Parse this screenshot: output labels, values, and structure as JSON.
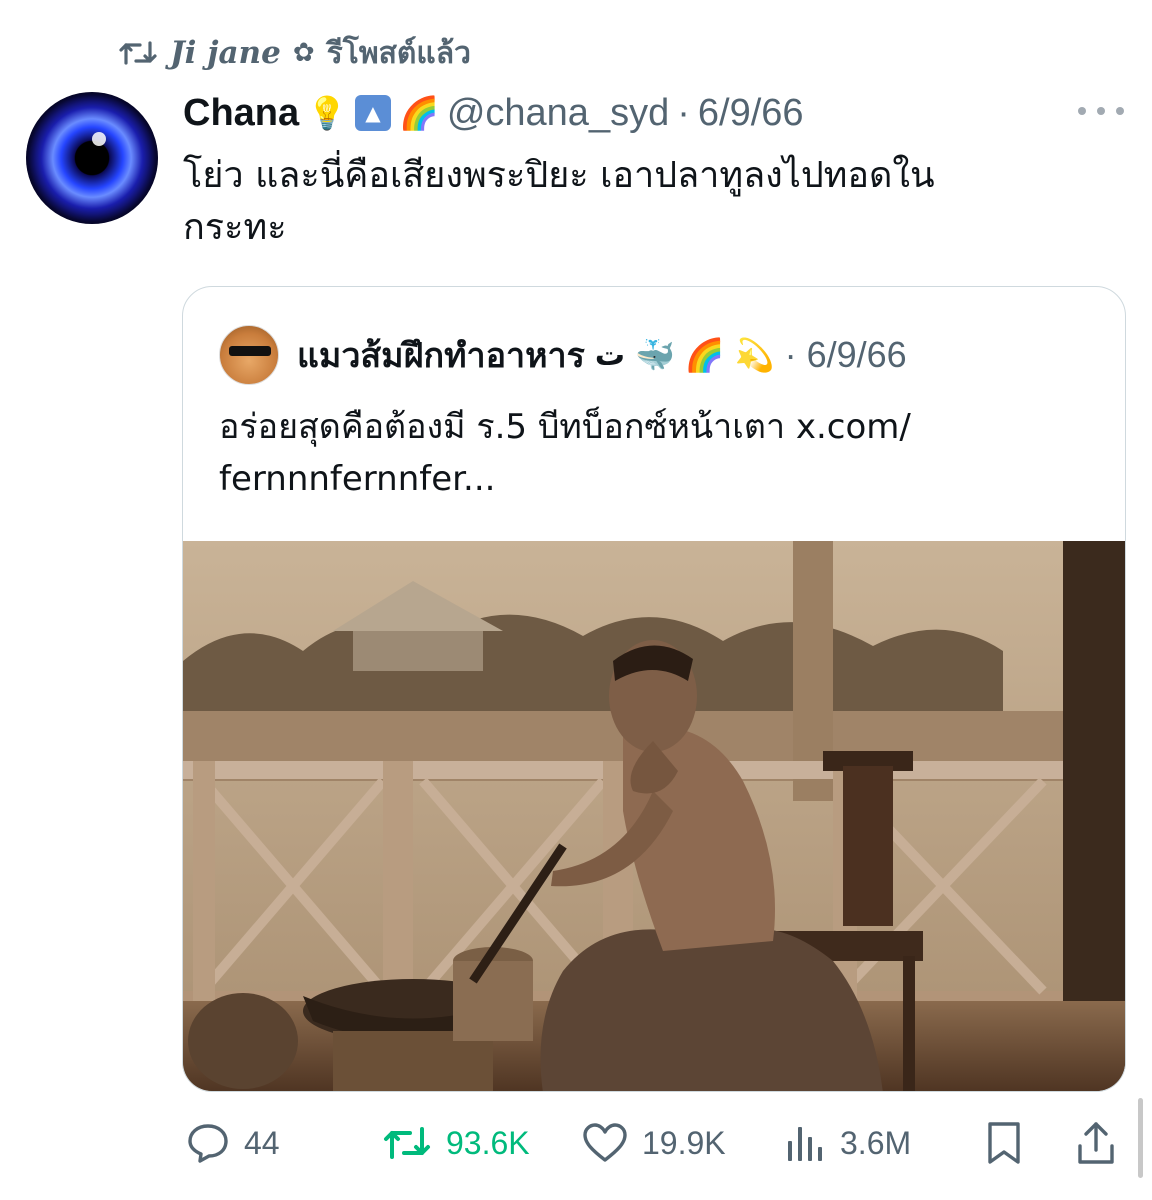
{
  "repost": {
    "user": "Ji jane",
    "flower": "✿",
    "label": "รีโพสต์แล้ว"
  },
  "tweet": {
    "author_name": "Chana",
    "author_emojis": [
      "💡",
      "🔼",
      "🌈"
    ],
    "handle": "@chana_syd",
    "separator": "·",
    "date": "6/9/66",
    "text": "โย่ว และนี่คือเสียงพระปิยะ เอาปลาทูลงไปทอดใน\nกระทะ"
  },
  "quote": {
    "author_name": "แมวส้มฝึกทำอาหาร",
    "name_suffix": "ت",
    "author_emojis": [
      "🐳",
      "🌈",
      "💫"
    ],
    "separator": "·",
    "date": "6/9/66",
    "text": "อร่อยสุดคือต้องมี ร.5 บีทบ็อกซ์หน้าเตา x.com/\nfernnnfernnfer..."
  },
  "actions": {
    "replies": "44",
    "reposts": "93.6K",
    "likes": "19.9K",
    "views": "3.6M"
  },
  "colors": {
    "text_primary": "#0f1419",
    "text_secondary": "#536471",
    "repost_green": "#00ba7c",
    "border": "#cfd9de"
  },
  "icons": [
    "retweet-icon",
    "more-icon",
    "reply-icon",
    "like-icon",
    "views-icon",
    "bookmark-icon",
    "share-icon"
  ]
}
